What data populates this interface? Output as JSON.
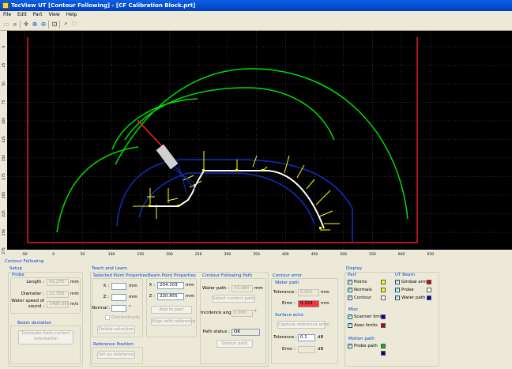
{
  "window": {
    "title": "TecView UT [Contour Following] - [CF Calibration Block.prt]"
  },
  "menu": [
    "File",
    "Edit",
    "Part",
    "View",
    "Help"
  ],
  "toolbar": {
    "icons": [
      "open-icon",
      "save-icon",
      "move-icon",
      "zoom-in-icon",
      "zoom-out-icon",
      "fit-icon",
      "probe-icon",
      "reset-icon"
    ]
  },
  "viewport": {
    "x_ticks": [
      "-50",
      "0",
      "50",
      "100",
      "150",
      "200",
      "250",
      "300",
      "350",
      "400",
      "450",
      "500",
      "550",
      "600",
      "650"
    ],
    "y_ticks": [
      "0",
      "25",
      "50",
      "75",
      "100",
      "125",
      "150",
      "175",
      "200",
      "225",
      "250",
      "275"
    ],
    "colors": {
      "background": "#000000",
      "grid": "#6a6a6a",
      "boundary": "#e02020",
      "part": "#ffffff",
      "normals": "#ffff00",
      "scanner": "#1030c0",
      "gimbal": "#ff2020",
      "probe": "#d0d0d0",
      "path": "#00e000"
    }
  },
  "panel": {
    "title": "Contour Following",
    "setup": {
      "title": "Setup",
      "probe": {
        "title": "Probe",
        "length_label": "Length :",
        "length_value": "41.275",
        "length_unit": "mm",
        "diameter_label": "Diameter :",
        "diameter_value": "12.700",
        "diameter_unit": "mm",
        "water_speed_label_1": "Water speed of",
        "water_speed_label_2": "sound :",
        "water_speed_value": "1485.000",
        "water_speed_unit": "m/s"
      },
      "beam_deviation": {
        "title": "Beam deviation",
        "compute_button": "Compute from current orientation"
      }
    },
    "teach": {
      "title": "Teach and Learn",
      "selected": {
        "title": "Selected Point Properties",
        "x_label": "X :",
        "x_value": "",
        "x_unit": "mm",
        "z_label": "Z :",
        "z_value": "",
        "z_unit": "mm",
        "normal_label": "Normal :",
        "normal_value": "",
        "normal_unit": "°",
        "discontinuity_label": "Discontinuity",
        "delete_button": "Delete selection"
      },
      "reference": {
        "title": "Reference Position",
        "set_button": "Set as reference"
      },
      "beam_point": {
        "title": "Beam Point Properties",
        "x_label": "X :",
        "x_value": "204.103",
        "x_unit": "mm",
        "z_label": "Z :",
        "z_value": "220.855",
        "z_unit": "mm",
        "add_button": "Add to part",
        "align_button": "Align with reference"
      },
      "path": {
        "title": "Contour Following Path",
        "water_path_label": "Water path :",
        "water_path_value": "53.484",
        "water_path_unit": "mm",
        "select_button": "Select current path",
        "incidence_label": "Incidence angle:",
        "incidence_value": "0.000",
        "incidence_unit": "°",
        "status_label": "Path status :",
        "status_value": "OK",
        "unlock_button": "Unlock path"
      }
    },
    "contour_error": {
      "title": "Contour error",
      "water_path": {
        "title": "Water path",
        "tolerance_label": "Tolerance :",
        "tolerance_value": "0.001",
        "tolerance_unit": "mm",
        "error_label": "Error :",
        "error_value": "0.154",
        "error_unit": "mm"
      },
      "surface_echo": {
        "title": "Surface echo",
        "capture_button": "Capture reference echo",
        "tolerance_label": "Tolerance :",
        "tolerance_value": "0.1",
        "tolerance_unit": "dB",
        "error_label": "Error :",
        "error_value": "",
        "error_unit": "dB"
      }
    },
    "display": {
      "title": "Display",
      "part": {
        "title": "Part",
        "items": [
          {
            "label": "Points",
            "color": "#ffff00"
          },
          {
            "label": "Normals",
            "color": "#ffff00"
          },
          {
            "label": "Contour",
            "color": "#ffffff"
          }
        ]
      },
      "misc": {
        "title": "Misc",
        "items": [
          {
            "label": "Scanner limits",
            "color": "#0000c0"
          },
          {
            "label": "Axes limits",
            "color": "#c00000"
          }
        ]
      },
      "motion_path": {
        "title": "Motion path",
        "items": [
          {
            "label": "Probe path",
            "color": "#00c000",
            "color2": "#000080"
          }
        ]
      },
      "ut_beam": {
        "title": "UT Beam",
        "items": [
          {
            "label": "Gimbal arm",
            "color": "#e00000"
          },
          {
            "label": "Probe",
            "color": "#ffffff"
          },
          {
            "label": "Water path",
            "color": "#0000c0"
          }
        ]
      }
    }
  }
}
